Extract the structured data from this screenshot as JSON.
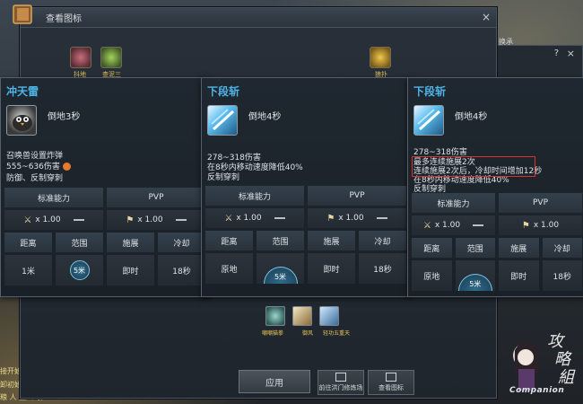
{
  "window": {
    "title": "查看图标",
    "close_label": "×"
  },
  "top_icons": {
    "labels": [
      "抖地",
      "查泥三",
      "狼扑"
    ]
  },
  "right_window": {
    "text": "换承",
    "help": "?",
    "close": "×"
  },
  "cards": [
    {
      "title": "冲天雷",
      "icon_label": "倒地3秒",
      "desc": [
        "召唤兽设置炸弹",
        "555~636伤害",
        "防御、反制穿刺"
      ],
      "table": {
        "headers": [
          "标准能力",
          "PVP"
        ],
        "std_value": "x 1.00",
        "pvp_value": "x 1.00",
        "sub_headers": [
          "距离",
          "范围",
          "施展",
          "冷却"
        ],
        "values": [
          "1米",
          "5米",
          "即时",
          "18秒"
        ]
      }
    },
    {
      "title": "下段斩",
      "icon_label": "倒地4秒",
      "desc": [
        "278~318伤害",
        "在8秒内移动速度降低40%",
        "反制穿刺"
      ],
      "table": {
        "headers": [
          "标准能力",
          "PVP"
        ],
        "std_value": "x 1.00",
        "pvp_value": "x 1.00",
        "sub_headers": [
          "距离",
          "范围",
          "施展",
          "冷却"
        ],
        "values": [
          "原地",
          "5米",
          "即时",
          "18秒"
        ]
      }
    },
    {
      "title": "下段斩",
      "icon_label": "倒地4秒",
      "desc": [
        "278~318伤害",
        "最多连续施展2次",
        "连续施展2次后，冷却时间增加12秒",
        "在8秒内移动速度降低40%",
        "反制穿刺"
      ],
      "table": {
        "headers": [
          "标准能力",
          "PVP"
        ],
        "std_value": "x 1.00",
        "pvp_value": "x 1.00",
        "sub_headers": [
          "距离",
          "范围",
          "施展",
          "冷却"
        ],
        "values": [
          "原地",
          "5米",
          "即时",
          "18秒"
        ]
      }
    }
  ],
  "bottom_icons": {
    "labels": [
      "嘲嘲猫拳",
      "御风",
      "轻功五重天"
    ]
  },
  "buttons": {
    "apply": "应用",
    "training": "前往洪门修炼场",
    "view_icons": "查看图标"
  },
  "bg_text": [
    "接开始。",
    "卸初始化。",
    "粮 人 鱼人 收"
  ],
  "watermark": {
    "text": "Companion",
    "calligraphy": "攻略組"
  }
}
